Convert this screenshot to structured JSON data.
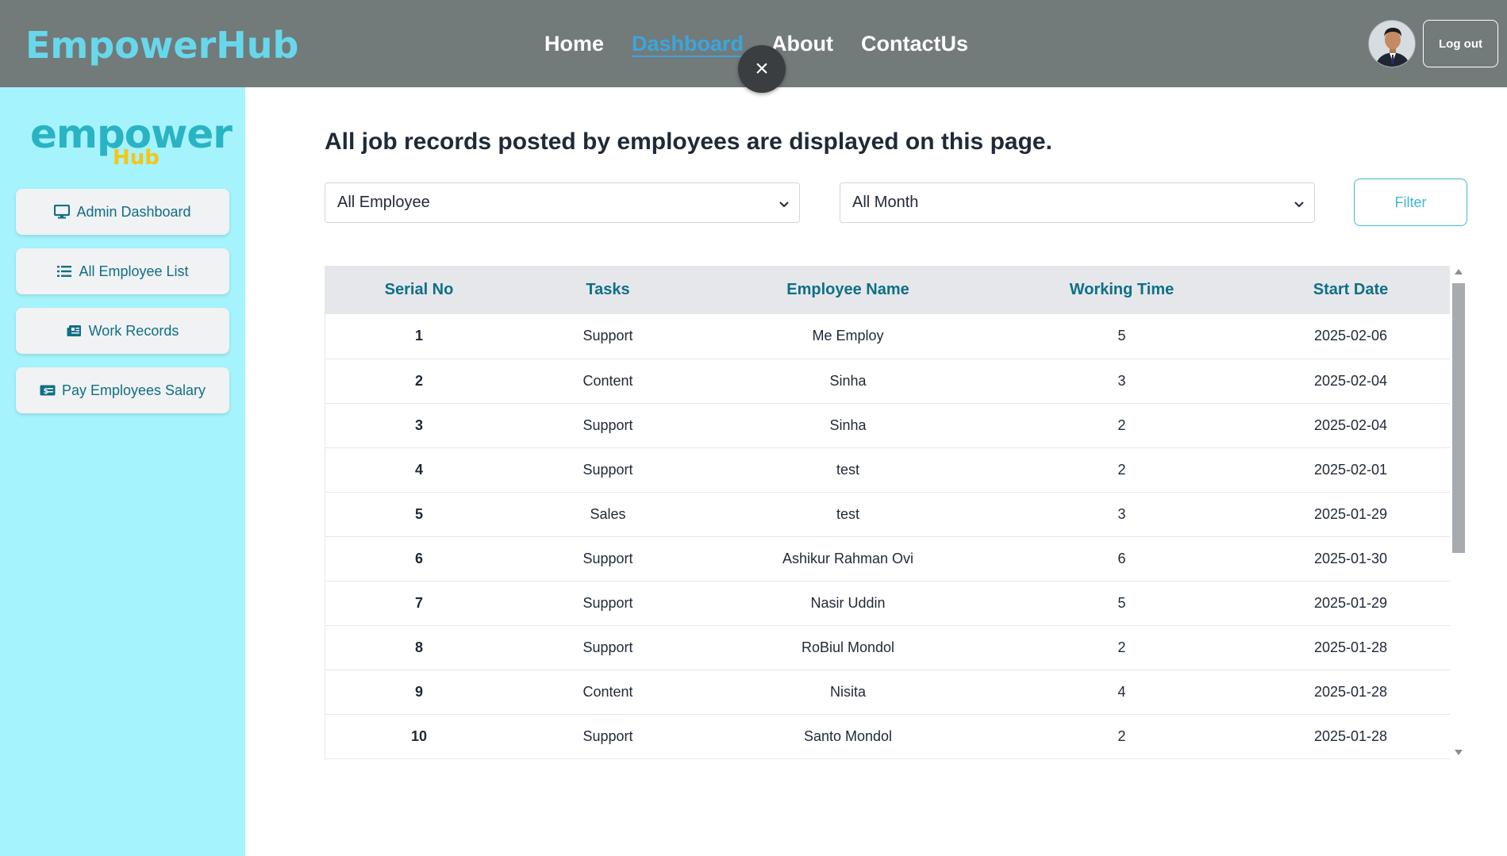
{
  "navbar": {
    "brand": "EmpowerHub",
    "links": [
      "Home",
      "Dashboard",
      "About",
      "ContactUs"
    ],
    "active_link": "Dashboard",
    "close_label": "×",
    "logout_label": "Log out"
  },
  "sidebar": {
    "logo_main": "empower",
    "logo_sub": "Hub",
    "items": [
      {
        "label": "Admin Dashboard",
        "icon": "monitor-icon"
      },
      {
        "label": "All Employee List",
        "icon": "list-icon"
      },
      {
        "label": "Work Records",
        "icon": "newspaper-icon"
      },
      {
        "label": "Pay Employees Salary",
        "icon": "money-bill-icon"
      }
    ]
  },
  "main": {
    "heading": "All job records posted by employees are displayed on this page.",
    "employee_select": "All Employee",
    "month_select": "All Month",
    "filter_label": "Filter"
  },
  "table": {
    "headers": [
      "Serial No",
      "Tasks",
      "Employee Name",
      "Working Time",
      "Start Date"
    ],
    "rows": [
      [
        "1",
        "Support",
        "Me Employ",
        "5",
        "2025-02-06"
      ],
      [
        "2",
        "Content",
        "Sinha",
        "3",
        "2025-02-04"
      ],
      [
        "3",
        "Support",
        "Sinha",
        "2",
        "2025-02-04"
      ],
      [
        "4",
        "Support",
        "test",
        "2",
        "2025-02-01"
      ],
      [
        "5",
        "Sales",
        "test",
        "3",
        "2025-01-29"
      ],
      [
        "6",
        "Support",
        "Ashikur Rahman Ovi",
        "6",
        "2025-01-30"
      ],
      [
        "7",
        "Support",
        "Nasir Uddin",
        "5",
        "2025-01-29"
      ],
      [
        "8",
        "Support",
        "RoBiul Mondol",
        "2",
        "2025-01-28"
      ],
      [
        "9",
        "Content",
        "Nisita",
        "4",
        "2025-01-28"
      ],
      [
        "10",
        "Support",
        "Santo Mondol",
        "2",
        "2025-01-28"
      ]
    ]
  },
  "colors": {
    "navbar_bg": "#737a7a",
    "sidebar_bg": "#a5f3fc",
    "accent": "#0e6f86",
    "brand": "#67d8ec"
  }
}
